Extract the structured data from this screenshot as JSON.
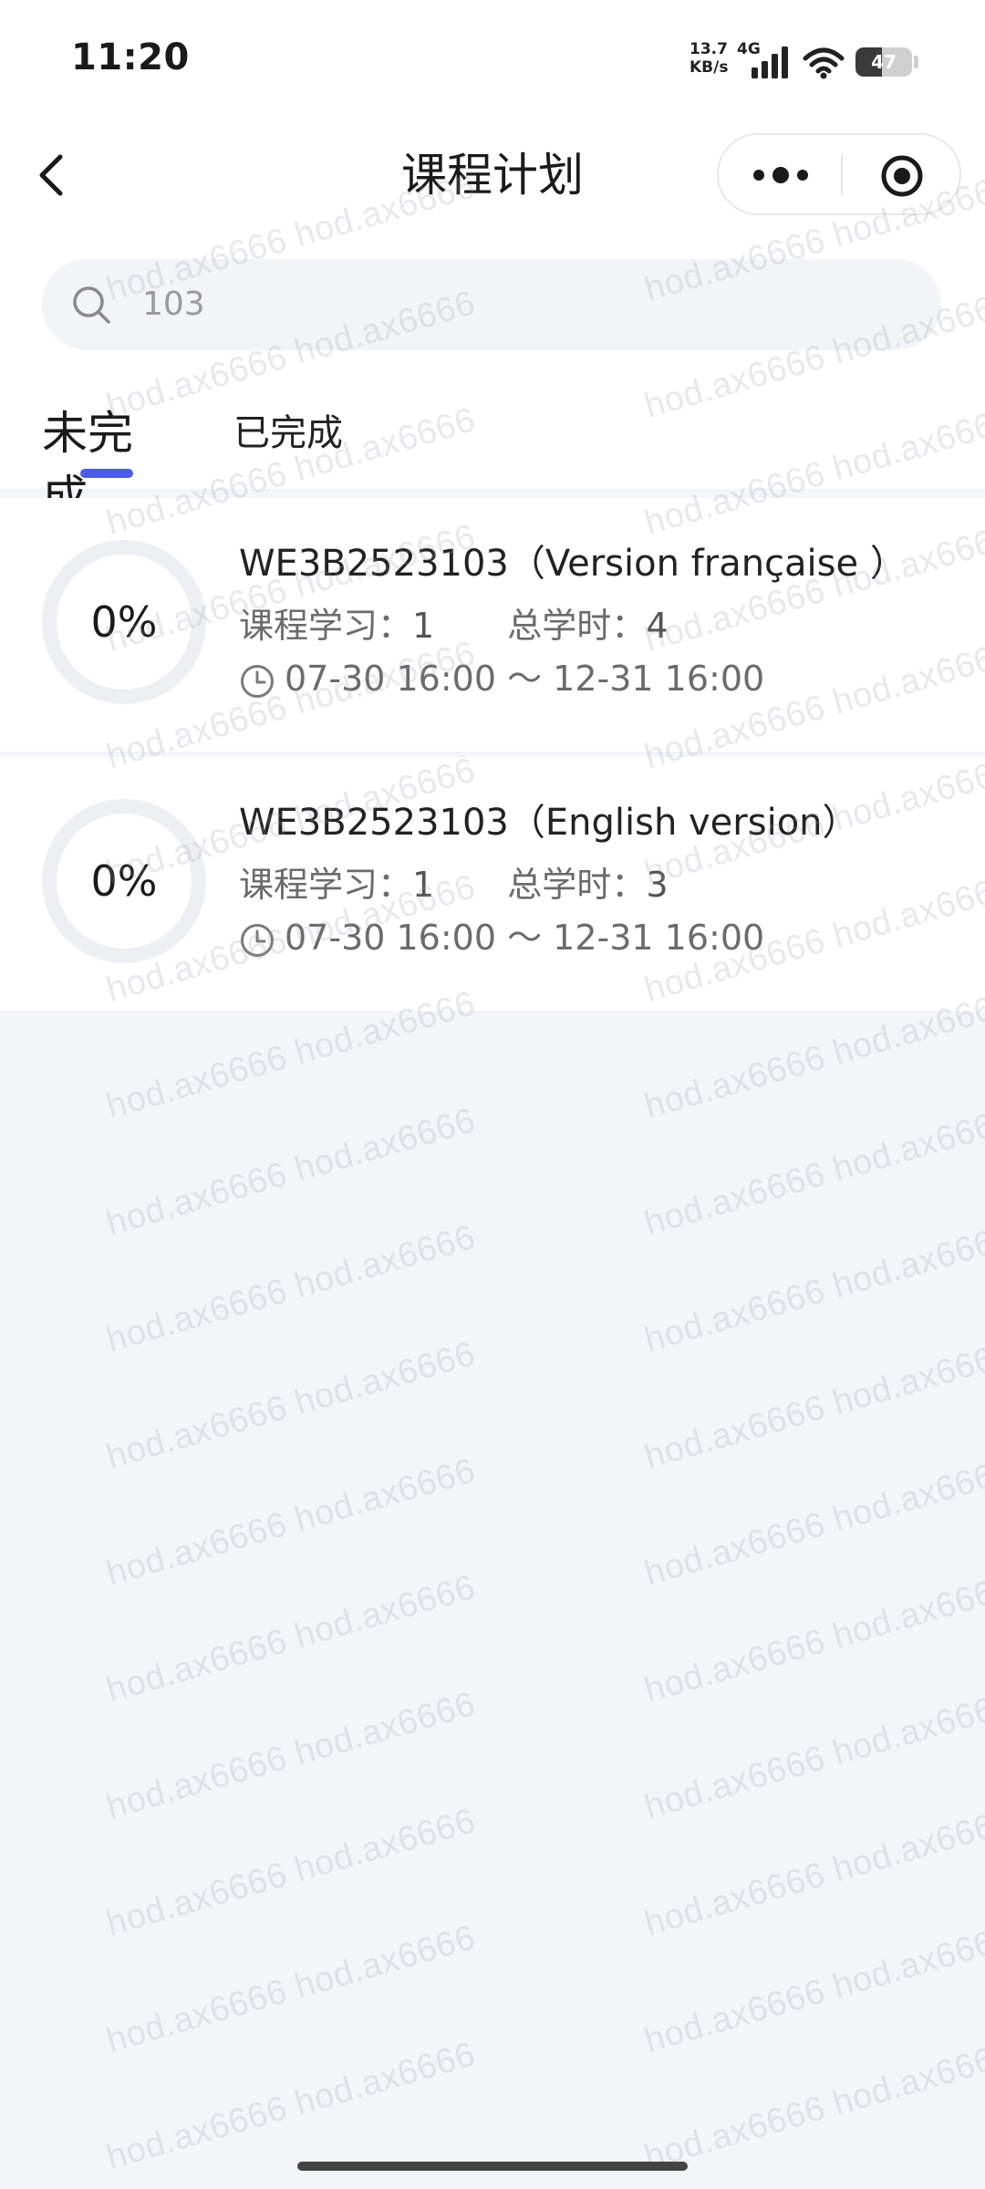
{
  "status_bar": {
    "time": "11:20",
    "net_speed": "13.7 KB/s",
    "net_type": "4G",
    "battery": "47"
  },
  "nav": {
    "title": "课程计划",
    "icons": [
      "back-icon",
      "more-icon",
      "close-miniprogram-icon"
    ]
  },
  "search": {
    "value": "103",
    "icon": "search-icon"
  },
  "tabs": [
    {
      "label": "未完成",
      "active": true
    },
    {
      "label": "已完成",
      "active": false
    }
  ],
  "courses": [
    {
      "progress": "0%",
      "progress_value": 0,
      "title": "WE3B2523103（Version française ）",
      "study_label": "课程学习：",
      "study_value": "1",
      "hours_label": "总学时：",
      "hours_value": "4",
      "time_range": "07-30 16:00 ～ 12-31 16:00"
    },
    {
      "progress": "0%",
      "progress_value": 0,
      "title": "WE3B2523103（English version）",
      "study_label": "课程学习：",
      "study_value": "1",
      "hours_label": "总学时：",
      "hours_value": "3",
      "time_range": "07-30 16:00 ～ 12-31 16:00"
    }
  ],
  "watermark": "hod.ax6666 hod.ax6666",
  "colors": {
    "accent": "#4b5ee8",
    "page_bg": "#f4f5f9",
    "ring_track": "#eeeff3",
    "text_secondary": "#6b6b6b"
  }
}
